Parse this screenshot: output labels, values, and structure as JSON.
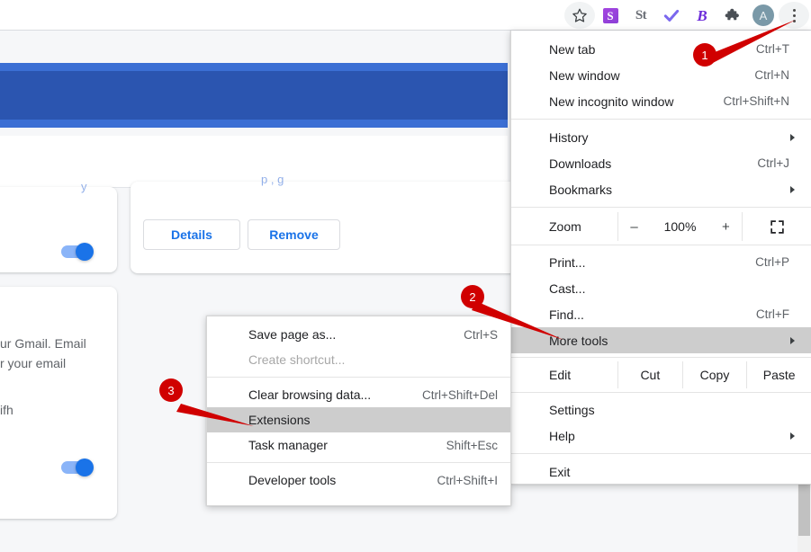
{
  "toolbar": {
    "bookmark_star": "☆",
    "extension_icons": [
      {
        "name": "extension-s-icon",
        "label": "S"
      },
      {
        "name": "extension-st-icon",
        "label": "St"
      },
      {
        "name": "extension-checkmark-icon",
        "label": "✔"
      },
      {
        "name": "extension-b-icon",
        "label": "B"
      },
      {
        "name": "extensions-puzzle-icon",
        "label": "puzzle"
      }
    ],
    "avatar_label": "A",
    "menu_button_name": "chrome-menu-kebab"
  },
  "chrome_menu": {
    "groups": [
      {
        "items": [
          {
            "label": "New tab",
            "accel": "Ctrl+T",
            "name": "menu-item-new-tab"
          },
          {
            "label": "New window",
            "accel": "Ctrl+N",
            "name": "menu-item-new-window"
          },
          {
            "label": "New incognito window",
            "accel": "Ctrl+Shift+N",
            "name": "menu-item-new-incognito-window"
          }
        ]
      },
      {
        "items": [
          {
            "label": "History",
            "accel": "",
            "submenu": true,
            "name": "menu-item-history"
          },
          {
            "label": "Downloads",
            "accel": "Ctrl+J",
            "name": "menu-item-downloads"
          },
          {
            "label": "Bookmarks",
            "accel": "",
            "submenu": true,
            "name": "menu-item-bookmarks"
          }
        ]
      },
      {
        "items": [
          {
            "label": "Print...",
            "accel": "Ctrl+P",
            "name": "menu-item-print"
          },
          {
            "label": "Cast...",
            "accel": "",
            "name": "menu-item-cast"
          },
          {
            "label": "Find...",
            "accel": "Ctrl+F",
            "name": "menu-item-find"
          },
          {
            "label": "More tools",
            "accel": "",
            "submenu": true,
            "highlighted": true,
            "name": "menu-item-more-tools"
          }
        ]
      },
      {
        "items": [
          {
            "label": "Settings",
            "accel": "",
            "name": "menu-item-settings"
          },
          {
            "label": "Help",
            "accel": "",
            "submenu": true,
            "name": "menu-item-help"
          }
        ]
      },
      {
        "items": [
          {
            "label": "Exit",
            "accel": "",
            "name": "menu-item-exit"
          }
        ]
      }
    ],
    "zoom_row": {
      "label": "Zoom",
      "minus": "–",
      "value": "100%",
      "plus": "+",
      "fullscreen_icon": "fullscreen-icon"
    },
    "edit_row": {
      "label": "Edit",
      "cut": "Cut",
      "copy": "Copy",
      "paste": "Paste"
    }
  },
  "more_tools_submenu": {
    "items": [
      {
        "label": "Save page as...",
        "accel": "Ctrl+S",
        "name": "submenu-item-save-page-as"
      },
      {
        "label": "Create shortcut...",
        "accel": "",
        "disabled": true,
        "name": "submenu-item-create-shortcut"
      },
      {
        "sep": true
      },
      {
        "label": "Clear browsing data...",
        "accel": "Ctrl+Shift+Del",
        "name": "submenu-item-clear-browsing-data"
      },
      {
        "label": "Extensions",
        "accel": "",
        "highlighted": true,
        "name": "submenu-item-extensions"
      },
      {
        "label": "Task manager",
        "accel": "Shift+Esc",
        "name": "submenu-item-task-manager"
      },
      {
        "sep": true
      },
      {
        "label": "Developer tools",
        "accel": "Ctrl+Shift+I",
        "name": "submenu-item-developer-tools"
      }
    ]
  },
  "page": {
    "card_text_line1": "ur Gmail. Email",
    "card_text_line2": "r your email",
    "card_text_line3": "ifh",
    "details_button": "Details",
    "remove_button": "Remove",
    "faded_link_left": "y",
    "faded_link_right": "p                         ,          g"
  },
  "annotations": [
    {
      "number": "1",
      "name": "annotation-marker-1"
    },
    {
      "number": "2",
      "name": "annotation-marker-2"
    },
    {
      "number": "3",
      "name": "annotation-marker-3"
    }
  ],
  "colors": {
    "marker_red": "#d00000",
    "highlight_gray": "#cdcdcd",
    "accent_blue": "#1a73e8",
    "header_blue": "#2b55b0"
  }
}
